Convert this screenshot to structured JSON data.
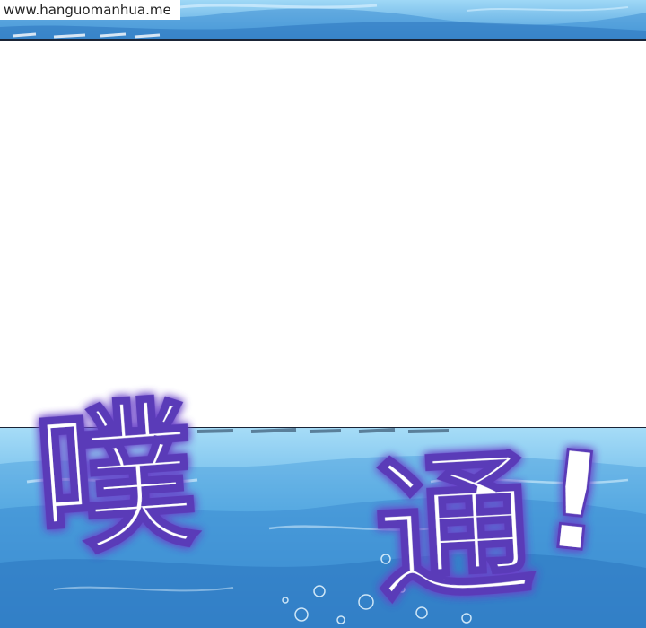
{
  "watermark": {
    "text": "www.hanguomanhua.me"
  },
  "sound_effect": {
    "char_1": "噗",
    "char_2": "通",
    "punctuation": "!"
  },
  "colors": {
    "water_light": "#8fd0f2",
    "water_mid": "#4fa6e0",
    "water_deep": "#2a78c4",
    "border": "#1a2436",
    "sfx_fill": "#ffffff",
    "sfx_glow": "#6a43c9"
  }
}
